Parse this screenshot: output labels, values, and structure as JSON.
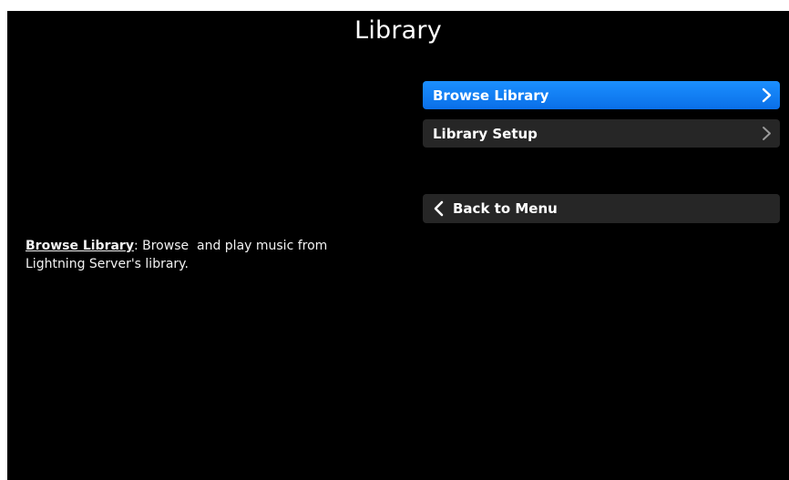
{
  "page": {
    "title": "Library"
  },
  "menu": {
    "items": [
      {
        "label": "Browse Library",
        "selected": true,
        "icon": "chevron-right-icon"
      },
      {
        "label": "Library Setup",
        "selected": false,
        "icon": "chevron-right-icon"
      }
    ],
    "back": {
      "label": "Back to Menu",
      "icon": "chevron-left-icon"
    }
  },
  "description": {
    "term": "Browse Library",
    "colon": ":",
    "text": " Browse  and play music from Lightning Server's library."
  },
  "colors": {
    "background": "#000000",
    "selected": "#1b8fff",
    "item": "#262626",
    "text": "#ffffff"
  }
}
